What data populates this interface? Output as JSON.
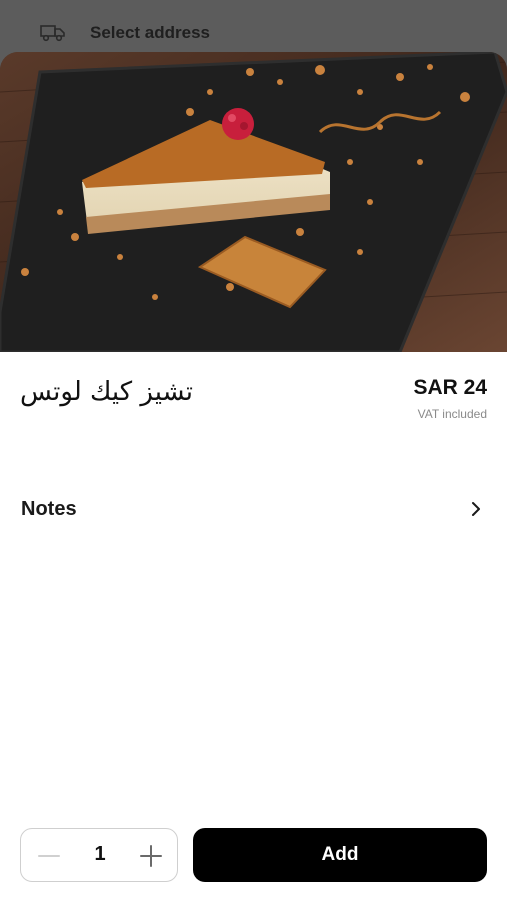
{
  "header": {
    "address_label": "Select address",
    "icon": "truck-icon"
  },
  "product": {
    "name": "تشيز كيك لوتس",
    "price": "SAR 24",
    "vat_note": "VAT included",
    "image": "lotus-cheesecake-photo"
  },
  "notes": {
    "label": "Notes",
    "icon": "chevron-right-icon"
  },
  "footer": {
    "quantity": "1",
    "add_label": "Add"
  },
  "colors": {
    "top_bar": "#5c5c5c",
    "add_button": "#000000",
    "muted_text": "#8a8a8a"
  }
}
